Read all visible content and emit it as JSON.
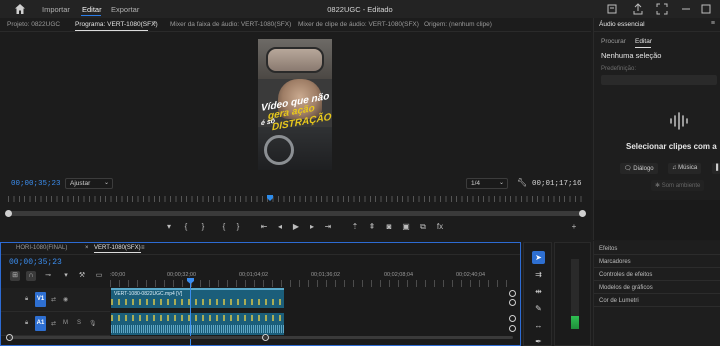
{
  "menu": {
    "items": [
      "Importar",
      "Editar",
      "Exportar"
    ],
    "active_index": 1,
    "title": "0822UGC - Editado"
  },
  "program_monitor": {
    "tabs": [
      "Projeto: 0822UGC",
      "Programa: VERT-1080(SFX)",
      "Mixer da faixa de áudio: VERT-1080(SFX)",
      "Mixer de clipe de áudio: VERT-1080(SFX)",
      "Origem: (nenhum clipe)"
    ],
    "active_tab_index": 1,
    "video_overlay": {
      "line1": "Vídeo que não",
      "line2": "gera ação",
      "line3": "é só",
      "line4": "DISTRAÇÃO"
    },
    "timecode_current": "00;00;35;23",
    "fit_dropdown": "Ajustar",
    "resolution_dropdown": "1/4",
    "duration": "00;01;17;16",
    "playhead_fraction": 0.46
  },
  "essential_audio": {
    "title": "Áudio essencial",
    "subtabs": [
      "Procurar",
      "Editar"
    ],
    "active_subtab_index": 1,
    "no_selection": "Nenhuma seleção",
    "preset_label": "Predefinição:",
    "select_prompt": "Selecionar clipes com a",
    "chips": [
      "Diálogo",
      "Música",
      "Som ambiente"
    ]
  },
  "collapsed_panels": [
    "Efeitos",
    "Marcadores",
    "Controles de efeitos",
    "Modelos de gráficos",
    "Cor de Lumetri"
  ],
  "timeline": {
    "tabs": [
      "HORI-1080(FINAL)",
      "VERT-1080(SFX)"
    ],
    "active_tab_index": 1,
    "timecode": "00;00;35;23",
    "ruler_labels": [
      ":00;00",
      "00;00;32;00",
      "00;01;04;02",
      "00;01;36;02",
      "00;02;08;04",
      "00;02;40;04"
    ],
    "tracks": [
      {
        "id": "V1",
        "kind": "video",
        "clip_name": "VERT-1080-0822UGC.mp4 [V]"
      },
      {
        "id": "A1",
        "kind": "audio",
        "toggles": [
          "M",
          "S"
        ]
      }
    ]
  },
  "tools": [
    "selection-tool",
    "track-select-tool",
    "ripple-edit-tool",
    "razor-tool",
    "slip-tool",
    "pen-tool"
  ],
  "audio_meter": {
    "level_fraction": 0.18
  },
  "colors": {
    "accent": "#2d7de9",
    "clip": "#1b5e7a",
    "track_tag": "#2e6fd1"
  }
}
